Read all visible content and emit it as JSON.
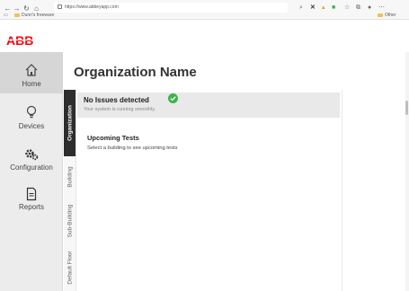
{
  "browser": {
    "url": "https://www.abbeyapp.com",
    "back_glyph": "←",
    "forward_glyph": "→",
    "refresh_glyph": "↻",
    "home_glyph": "⌂",
    "bookmarks": [
      {
        "label": "Dunn's freeware"
      },
      {
        "label": "Other favorites"
      }
    ]
  },
  "brand": {
    "logo_text": "ABB",
    "logo_color": "#ff000f"
  },
  "sidebar": {
    "items": [
      {
        "label": "Home",
        "icon": "home-icon",
        "active": true
      },
      {
        "label": "Devices",
        "icon": "lightbulb-icon",
        "active": false
      },
      {
        "label": "Configuration",
        "icon": "gear-icon",
        "active": false
      },
      {
        "label": "Reports",
        "icon": "document-icon",
        "active": false
      }
    ]
  },
  "main": {
    "title": "Organization Name",
    "tabs": [
      {
        "label": "Organization",
        "active": true
      },
      {
        "label": "Building",
        "active": false
      },
      {
        "label": "Sub-Building",
        "active": false
      },
      {
        "label": "Default Floor",
        "active": false
      }
    ],
    "status": {
      "title": "No Issues detected",
      "subtitle": "Your system is running smoothly.",
      "icon": "check-circle-icon",
      "color": "#3ab54a"
    },
    "upcoming": {
      "title": "Upcoming Tests",
      "text": "Select a building to see upcoming tests"
    }
  }
}
